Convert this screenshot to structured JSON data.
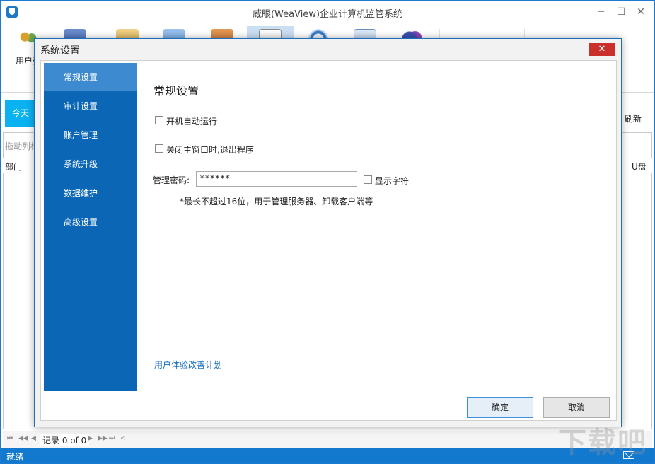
{
  "window": {
    "title": "威眼(WeaView)企业计算机监管系统",
    "minimize": "─",
    "maximize": "☐",
    "close": "✕"
  },
  "toolbar": {
    "items": [
      {
        "label": "用户列",
        "icon": "users-icon"
      },
      {
        "label": "",
        "icon": "monitor-icon"
      },
      {
        "label": "",
        "icon": "contacts-icon"
      },
      {
        "label": "",
        "icon": "screen-icon"
      },
      {
        "label": "",
        "icon": "briefcase-icon"
      },
      {
        "label": "",
        "icon": "document-icon"
      },
      {
        "label": "",
        "icon": "browser-icon"
      },
      {
        "label": "",
        "icon": "mail-icon"
      },
      {
        "label": "",
        "icon": "chat-icon"
      }
    ]
  },
  "background": {
    "today_tab": "今天",
    "refresh": "刷新",
    "drag_hint": "拖动列标",
    "col_dept": "部门",
    "col_usb": "U盘",
    "pager_text": "记录 0 of 0",
    "status": "就绪",
    "watermark": "下载吧"
  },
  "dialog": {
    "title": "系统设置",
    "close": "✕",
    "sidebar": [
      {
        "label": "常规设置",
        "active": true
      },
      {
        "label": "审计设置",
        "active": false
      },
      {
        "label": "账户管理",
        "active": false
      },
      {
        "label": "系统升级",
        "active": false
      },
      {
        "label": "数据维护",
        "active": false
      },
      {
        "label": "高级设置",
        "active": false
      }
    ],
    "section_title": "常规设置",
    "autostart_label": "开机自动运行",
    "autostart_checked": false,
    "exit_on_close_label": "关闭主窗口时,退出程序",
    "exit_on_close_checked": false,
    "password_label": "管理密码:",
    "password_value": "******",
    "show_chars_label": "显示字符",
    "show_chars_checked": false,
    "note": "*最长不超过16位，用于管理服务器、卸载客户端等",
    "ux_link": "用户体验改善计划",
    "ok_button": "确定",
    "cancel_button": "取消"
  }
}
